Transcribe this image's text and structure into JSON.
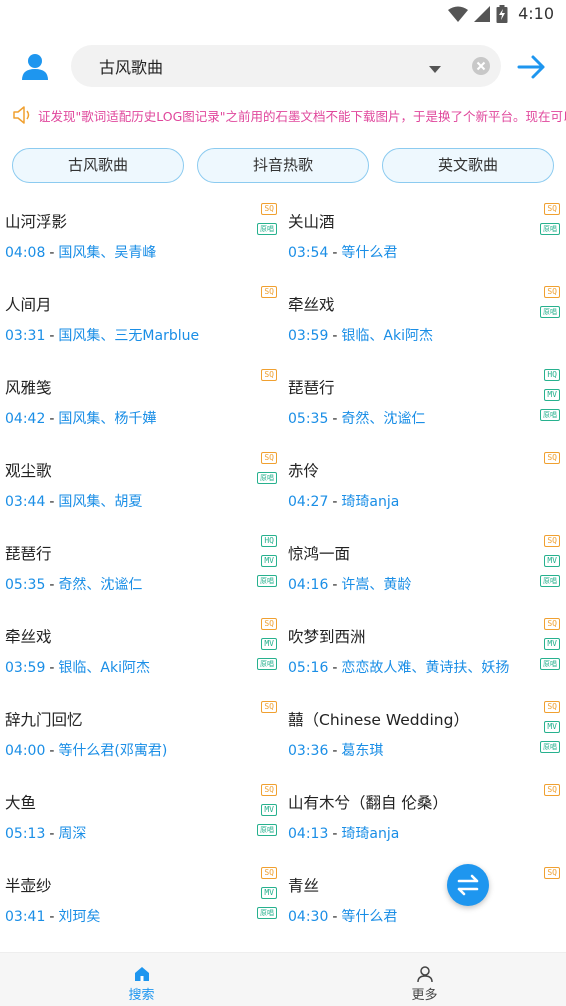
{
  "status_bar": {
    "time": "4:10",
    "icons": [
      "wifi-icon",
      "signal-icon",
      "battery-charging-icon"
    ]
  },
  "search": {
    "value": "古风歌曲",
    "icons": [
      "user-avatar-icon",
      "dropdown-arrow-icon",
      "clear-icon",
      "arrow-right-icon"
    ]
  },
  "notice": {
    "icon": "speaker-icon",
    "text": "证发现\"歌词适配历史LOG图记录\"之前用的石墨文档不能下载图片，于是换了个新平台。现在可以下载了"
  },
  "tags": [
    "古风歌曲",
    "抖音热歌",
    "英文歌曲"
  ],
  "songs": [
    {
      "title": "山河浮影",
      "duration": "04:08",
      "artists": "国风集、吴青峰",
      "badges": [
        "SQ",
        "原唱"
      ]
    },
    {
      "title": "关山酒",
      "duration": "03:54",
      "artists": "等什么君",
      "badges": [
        "SQ",
        "原唱"
      ]
    },
    {
      "title": "人间月",
      "duration": "03:31",
      "artists": "国风集、三无Marblue",
      "badges": [
        "SQ"
      ]
    },
    {
      "title": "牵丝戏",
      "duration": "03:59",
      "artists": "银临、Aki阿杰",
      "badges": [
        "SQ",
        "原唱"
      ]
    },
    {
      "title": "风雅笺",
      "duration": "04:42",
      "artists": "国风集、杨千嬅",
      "badges": [
        "SQ"
      ]
    },
    {
      "title": "琵琶行",
      "duration": "05:35",
      "artists": "奇然、沈谧仁",
      "badges": [
        "HQ",
        "MV",
        "原唱"
      ]
    },
    {
      "title": "观尘歌",
      "duration": "03:44",
      "artists": "国风集、胡夏",
      "badges": [
        "SQ",
        "原唱"
      ]
    },
    {
      "title": "赤伶",
      "duration": "04:27",
      "artists": "琦琦anja",
      "badges": [
        "SQ"
      ]
    },
    {
      "title": "琵琶行",
      "duration": "05:35",
      "artists": "奇然、沈谧仁",
      "badges": [
        "HQ",
        "MV",
        "原唱"
      ]
    },
    {
      "title": "惊鸿一面",
      "duration": "04:16",
      "artists": "许嵩、黄龄",
      "badges": [
        "SQ",
        "MV",
        "原唱"
      ]
    },
    {
      "title": "牵丝戏",
      "duration": "03:59",
      "artists": "银临、Aki阿杰",
      "badges": [
        "SQ",
        "MV",
        "原唱"
      ]
    },
    {
      "title": "吹梦到西洲",
      "duration": "05:16",
      "artists": "恋恋故人难、黄诗扶、妖扬",
      "badges": [
        "SQ",
        "MV",
        "原唱"
      ]
    },
    {
      "title": "辞九门回忆",
      "duration": "04:00",
      "artists": "等什么君(邓寓君)",
      "badges": [
        "SQ"
      ]
    },
    {
      "title": "囍（Chinese Wedding）",
      "duration": "03:36",
      "artists": "葛东琪",
      "badges": [
        "SQ",
        "MV",
        "原唱"
      ]
    },
    {
      "title": "大鱼",
      "duration": "05:13",
      "artists": "周深",
      "badges": [
        "SQ",
        "MV",
        "原唱"
      ]
    },
    {
      "title": "山有木兮（翻自 伦桑）",
      "duration": "04:13",
      "artists": "琦琦anja",
      "badges": [
        "SQ"
      ]
    },
    {
      "title": "半壶纱",
      "duration": "03:41",
      "artists": "刘珂矣",
      "badges": [
        "SQ",
        "MV",
        "原唱"
      ]
    },
    {
      "title": "青丝",
      "duration": "04:30",
      "artists": "等什么君",
      "badges": [
        "SQ"
      ]
    }
  ],
  "fab": {
    "icon": "swap-icon"
  },
  "bottom_nav": [
    {
      "label": "搜索",
      "icon": "home-icon",
      "active": true
    },
    {
      "label": "更多",
      "icon": "person-icon",
      "active": false
    }
  ],
  "colors": {
    "accent": "#1e96ef",
    "notice": "#e0479c",
    "sq": "#f0a030",
    "hq": "#27b18e"
  }
}
